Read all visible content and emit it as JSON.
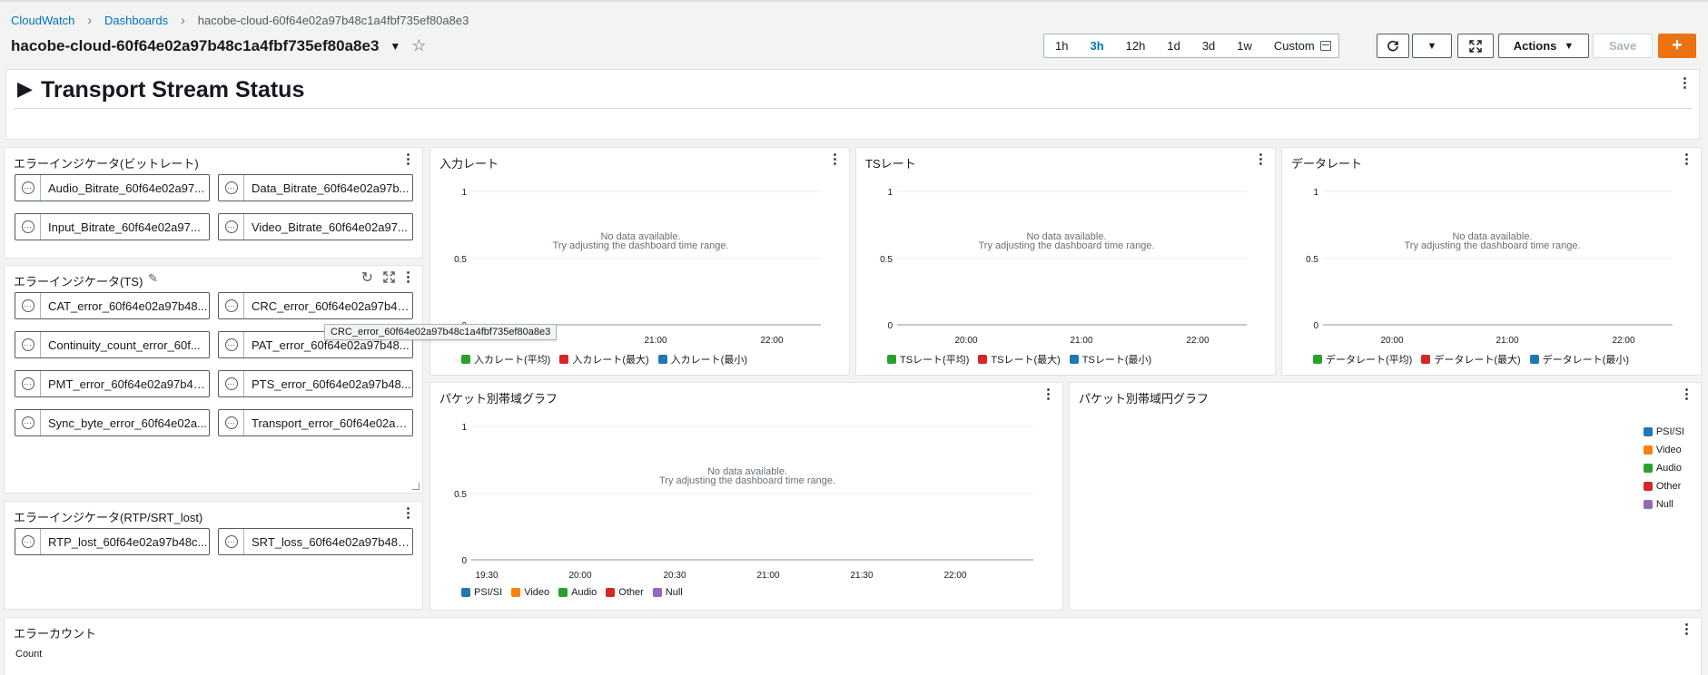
{
  "breadcrumb": {
    "items": [
      "CloudWatch",
      "Dashboards"
    ],
    "current": "hacobe-cloud-60f64e02a97b48c1a4fbf735ef80a8e3"
  },
  "title": "hacobe-cloud-60f64e02a97b48c1a4fbf735ef80a8e3",
  "toolbar": {
    "ranges": [
      "1h",
      "3h",
      "12h",
      "1d",
      "3d",
      "1w"
    ],
    "active_range": "3h",
    "custom_label": "Custom",
    "actions_label": "Actions",
    "save_label": "Save",
    "add_label": "+"
  },
  "section": {
    "title": "Transport Stream Status"
  },
  "panels": {
    "bitrate_alarms": {
      "title": "エラーインジケータ(ビットレート)",
      "alarms": [
        "Audio_Bitrate_60f64e02a97...",
        "Data_Bitrate_60f64e02a97b...",
        "Input_Bitrate_60f64e02a97...",
        "Video_Bitrate_60f64e02a97..."
      ]
    },
    "ts_alarms": {
      "title": "エラーインジケータ(TS)",
      "alarms": [
        "CAT_error_60f64e02a97b48...",
        "CRC_error_60f64e02a97b48...",
        "Continuity_count_error_60f...",
        "PAT_error_60f64e02a97b48...",
        "PMT_error_60f64e02a97b48...",
        "PTS_error_60f64e02a97b48...",
        "Sync_byte_error_60f64e02a...",
        "Transport_error_60f64e02a9..."
      ],
      "tooltip": "CRC_error_60f64e02a97b48c1a4fbf735ef80a8e3"
    },
    "rtp_alarms": {
      "title": "エラーインジケータ(RTP/SRT_lost)",
      "alarms": [
        "RTP_lost_60f64e02a97b48c...",
        "SRT_loss_60f64e02a97b48c..."
      ]
    },
    "input_rate": {
      "title": "入力レート",
      "nodata_1": "No data available.",
      "nodata_2": "Try adjusting the dashboard time range.",
      "legend": [
        "入カレート(平均)",
        "入カレート(最大)",
        "入カレート(最小)"
      ]
    },
    "ts_rate": {
      "title": "TSレート",
      "nodata_1": "No data available.",
      "nodata_2": "Try adjusting the dashboard time range.",
      "legend": [
        "TSレート(平均)",
        "TSレート(最大)",
        "TSレート(最小)"
      ]
    },
    "data_rate": {
      "title": "データレート",
      "nodata_1": "No data available.",
      "nodata_2": "Try adjusting the dashboard time range.",
      "legend": [
        "データレート(平均)",
        "データレート(最大)",
        "データレート(最小)"
      ]
    },
    "packet_bandwidth": {
      "title": "パケット別帯域グラフ",
      "nodata_1": "No data available.",
      "nodata_2": "Try adjusting the dashboard time range.",
      "legend": [
        "PSI/SI",
        "Video",
        "Audio",
        "Other",
        "Null"
      ]
    },
    "packet_pie": {
      "title": "パケット別帯域円グラフ",
      "legend": [
        "PSI/SI",
        "Video",
        "Audio",
        "Other",
        "Null"
      ]
    },
    "error_count": {
      "title": "エラーカウント",
      "ylabel": "Count"
    }
  },
  "colors": {
    "green": "#2ca02c",
    "red": "#d62728",
    "blue": "#1f77b4",
    "orange": "#ff7f0e",
    "purple": "#9467bd",
    "link": "#0073bb",
    "accent": "#ec7211"
  },
  "chart_data": [
    {
      "type": "line",
      "title": "入力レート",
      "y_ticks": [
        1,
        0.5,
        0
      ],
      "x_ticks": [
        "21:00",
        "22:00"
      ],
      "series": [
        {
          "name": "入カレート(平均)",
          "values": []
        },
        {
          "name": "入カレート(最大)",
          "values": []
        },
        {
          "name": "入カレート(最小)",
          "values": []
        }
      ]
    },
    {
      "type": "line",
      "title": "TSレート",
      "y_ticks": [
        1,
        0.5,
        0
      ],
      "x_ticks": [
        "20:00",
        "21:00",
        "22:00"
      ],
      "series": [
        {
          "name": "TSレート(平均)",
          "values": []
        },
        {
          "name": "TSレート(最大)",
          "values": []
        },
        {
          "name": "TSレート(最小)",
          "values": []
        }
      ]
    },
    {
      "type": "line",
      "title": "データレート",
      "y_ticks": [
        1,
        0.5,
        0
      ],
      "x_ticks": [
        "20:00",
        "21:00",
        "22:00"
      ],
      "series": [
        {
          "name": "データレート(平均)",
          "values": []
        },
        {
          "name": "データレート(最大)",
          "values": []
        },
        {
          "name": "データレート(最小)",
          "values": []
        }
      ]
    },
    {
      "type": "line",
      "title": "パケット別帯域グラフ",
      "y_ticks": [
        1,
        0.5,
        0
      ],
      "x_ticks": [
        "19:30",
        "20:00",
        "20:30",
        "21:00",
        "21:30",
        "22:00"
      ],
      "series": [
        {
          "name": "PSI/SI",
          "values": []
        },
        {
          "name": "Video",
          "values": []
        },
        {
          "name": "Audio",
          "values": []
        },
        {
          "name": "Other",
          "values": []
        },
        {
          "name": "Null",
          "values": []
        }
      ]
    },
    {
      "type": "pie",
      "title": "パケット別帯域円グラフ",
      "categories": [
        "PSI/SI",
        "Video",
        "Audio",
        "Other",
        "Null"
      ],
      "values": []
    }
  ]
}
